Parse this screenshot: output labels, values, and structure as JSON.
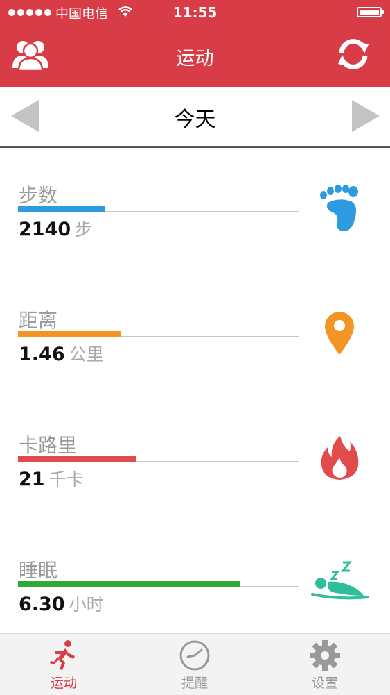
{
  "status_bar": {
    "carrier": "中国电信",
    "time": "11:55"
  },
  "header": {
    "title": "运动",
    "left_icon": "friends-icon",
    "right_icon": "sync-icon"
  },
  "date_nav": {
    "label": "今天"
  },
  "stats": [
    {
      "label": "步数",
      "value": "2140",
      "unit": "步",
      "progress": 0.31,
      "color": "#2e9be0",
      "icon": "footprint-icon"
    },
    {
      "label": "距离",
      "value": "1.46",
      "unit": "公里",
      "progress": 0.366,
      "color": "#f39524",
      "icon": "location-pin-icon"
    },
    {
      "label": "卡路里",
      "value": "21",
      "unit": "千卡",
      "progress": 0.422,
      "color": "#e14b4b",
      "icon": "flame-icon"
    },
    {
      "label": "睡眠",
      "value": "6.30",
      "unit": "小时",
      "progress": 0.79,
      "color": "#2eaa3a",
      "icon": "sleep-icon"
    }
  ],
  "tabs": [
    {
      "label": "运动",
      "icon": "runner-icon",
      "active": true,
      "color": "#d83c46"
    },
    {
      "label": "提醒",
      "icon": "clock-icon",
      "active": false,
      "color": "#999999"
    },
    {
      "label": "设置",
      "icon": "gear-icon",
      "active": false,
      "color": "#999999"
    }
  ]
}
